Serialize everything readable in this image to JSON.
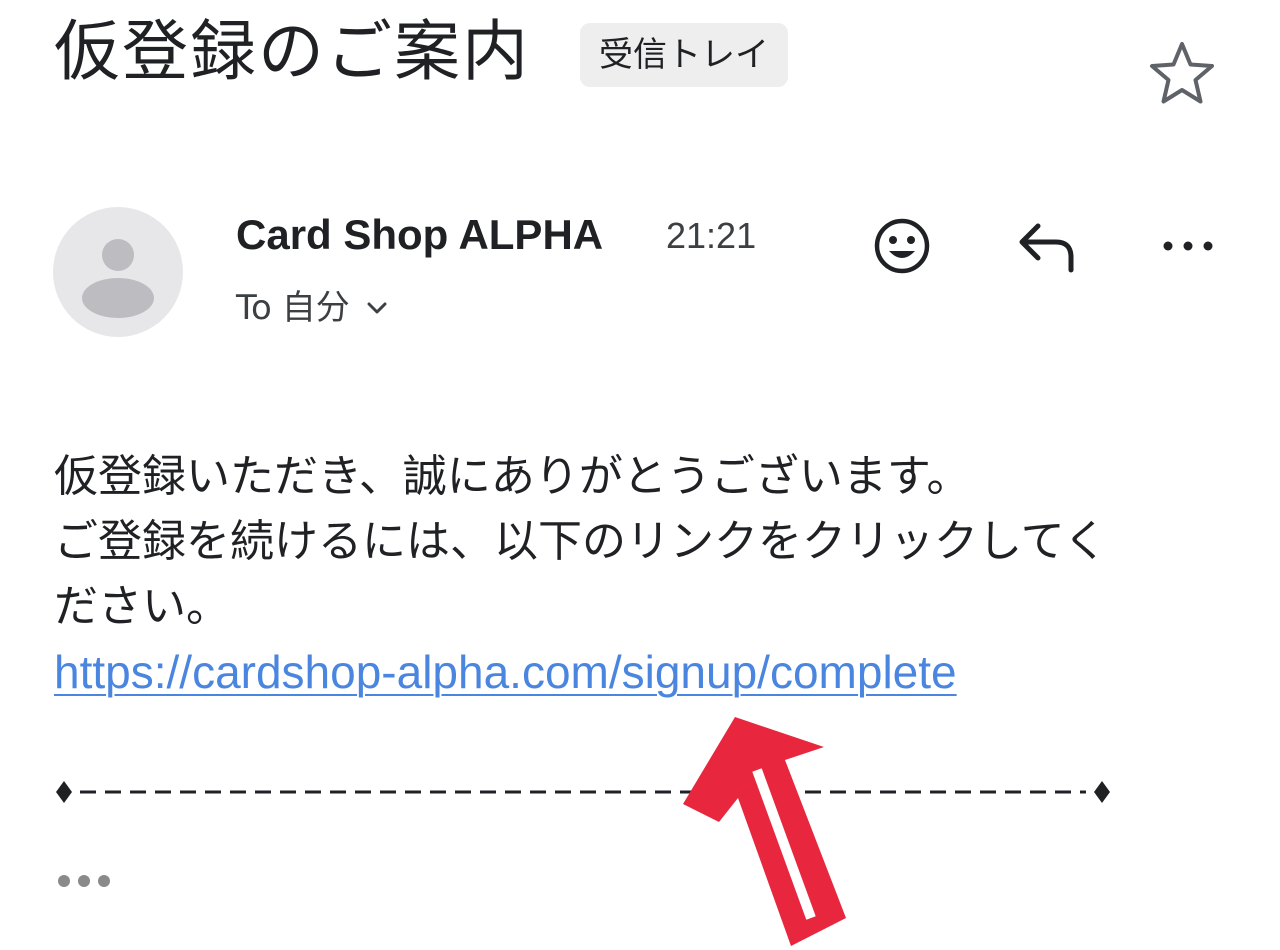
{
  "email": {
    "subject": "仮登録のご案内",
    "label_chip": "受信トレイ",
    "sender": "Card Shop ALPHA",
    "time": "21:21",
    "recipient_prefix": "To",
    "recipient_name": "自分",
    "body_lines": [
      "仮登録いただき、誠にありがとうございます。",
      "ご登録を続けるには、以下のリンクをクリックしてく",
      "ださい。"
    ],
    "link": "https://cardshop-alpha.com/signup/complete"
  },
  "colors": {
    "link": "#4a86e0",
    "annotation_arrow": "#e8273f",
    "chip_bg": "#eeeeee",
    "avatar_bg": "#e7e7ea"
  },
  "icons": {
    "star": "star-outline-icon",
    "emoji": "smiley-icon",
    "reply": "reply-icon",
    "more": "more-horizontal-icon",
    "recipient_toggle": "chevron-down-icon",
    "quoted_text": "ellipsis-icon"
  }
}
